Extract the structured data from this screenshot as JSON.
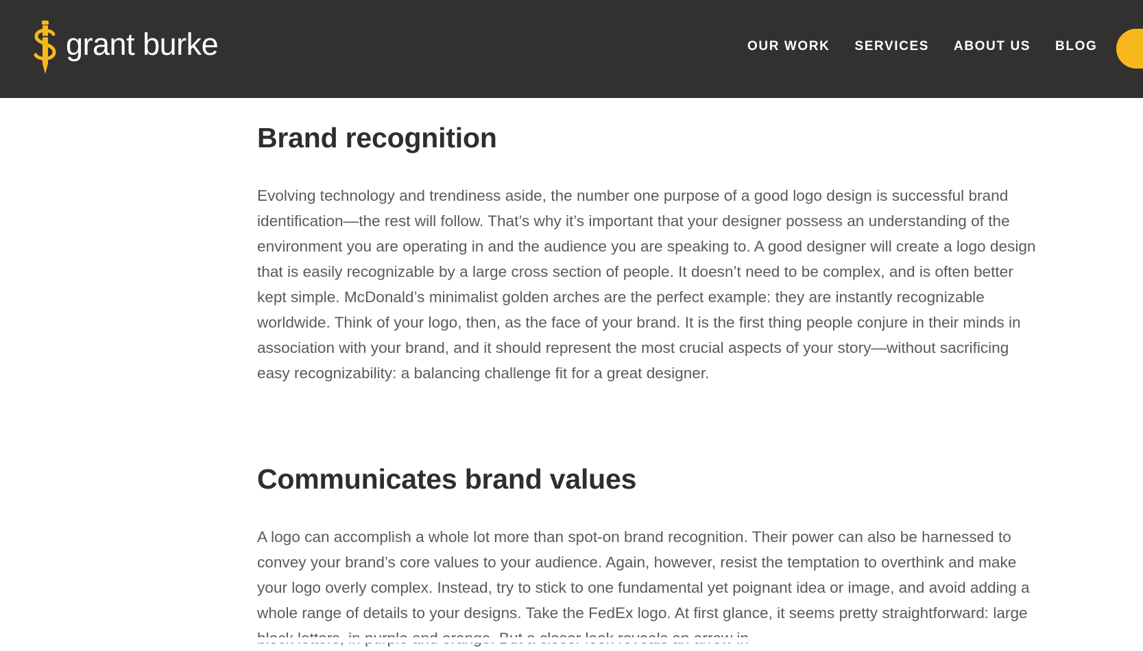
{
  "brand": {
    "name": "grant burke",
    "logo_icon": "pencil-dollar-icon",
    "accent_color": "#f8b81d",
    "header_bg": "#323130"
  },
  "nav": {
    "items": [
      {
        "label": "OUR WORK"
      },
      {
        "label": "SERVICES"
      },
      {
        "label": "ABOUT US"
      },
      {
        "label": "BLOG"
      }
    ]
  },
  "article": {
    "sections": [
      {
        "heading": "Brand recognition",
        "body": "Evolving technology and trendiness aside, the number one purpose of a good logo design is successful brand identification—the rest will follow. That’s why it’s important that your designer possess an understanding of the environment you are operating in and the audience you are speaking to. A good designer will create a logo design that is easily recognizable by a large cross section of people. It doesn’t need to be complex, and is often better kept simple. McDonald’s minimalist golden arches are the perfect example: they are instantly recognizable worldwide. Think of your logo, then, as the face of your brand. It is the first thing people conjure in their minds in association with your brand, and it should represent the most crucial aspects of your story—without sacrificing easy recognizability: a balancing challenge fit for a great designer."
      },
      {
        "heading": "Communicates brand values",
        "body": "A logo can accomplish a whole lot more than spot-on brand recognition. Their power can also be harnessed to convey your brand’s core values to your audience. Again, however, resist the temptation to overthink and make your logo overly complex. Instead, try to stick to one fundamental yet poignant idea or image, and avoid adding a whole range of details to your designs. Take the FedEx logo. At first glance, it seems pretty straightforward: large block letters, in purple and orange. But a closer look reveals an arrow in"
      }
    ]
  }
}
